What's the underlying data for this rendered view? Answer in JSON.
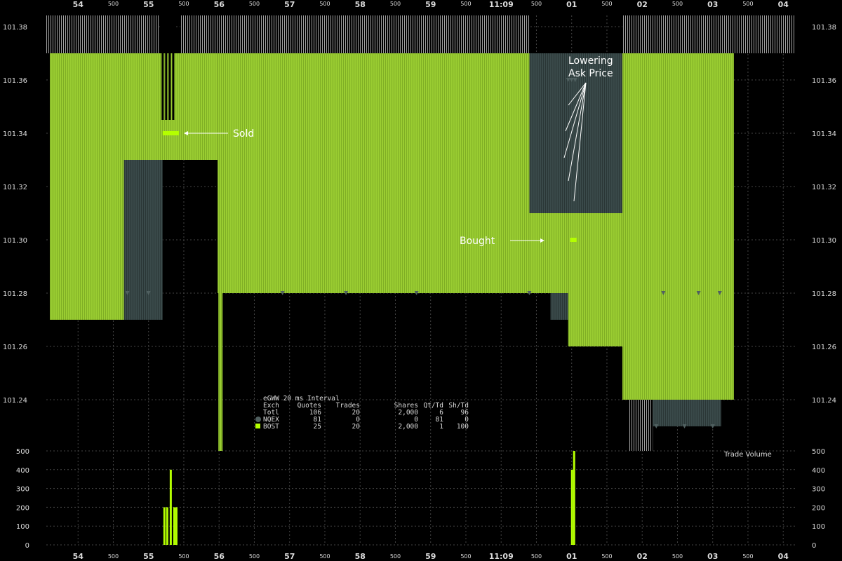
{
  "chart_data": {
    "type": "area",
    "title": "eGWW 20 ms Interval",
    "time_axis": {
      "major_labels": [
        "54",
        "55",
        "56",
        "57",
        "58",
        "59",
        "11:09",
        "01",
        "02",
        "03",
        "04"
      ],
      "minor_label": "500"
    },
    "price_axis": {
      "range": [
        101.23,
        101.39
      ],
      "ticks": [
        "101.38",
        "101.36",
        "101.34",
        "101.32",
        "101.30",
        "101.28",
        "101.26",
        "101.24"
      ]
    },
    "volume_axis": {
      "label": "Trade Volume",
      "range": [
        0,
        500
      ],
      "ticks": [
        "500",
        "400",
        "300",
        "200",
        "100",
        "0"
      ]
    },
    "colors": {
      "bost": "#9acd32",
      "bost_bright": "#b4ff00",
      "nqex": "#3a4a4a",
      "nqex_marker": "#506060",
      "grid": "#444444",
      "quote_vertical": "#a0a0a0"
    },
    "bost_bid": [
      {
        "t_start": 53.6,
        "t_end": 54.65,
        "price": 101.27
      },
      {
        "t_start": 54.65,
        "t_end": 55.98,
        "price": 101.28
      },
      {
        "t_start": 55.98,
        "t_end": 60.9,
        "price": 101.28
      },
      {
        "t_start": 60.9,
        "t_end": 61.3,
        "price": 101.3
      },
      {
        "t_start": 61.3,
        "t_end": 61.9,
        "price": 101.26
      },
      {
        "t_start": 61.9,
        "t_end": 63.3,
        "price": 101.24
      }
    ],
    "bost_ask": [
      {
        "t_start": 53.6,
        "t_end": 56.02,
        "price": 101.37
      },
      {
        "t_start": 56.02,
        "t_end": 60.4,
        "price": 101.37
      },
      {
        "t_start": 60.4,
        "t_end": 60.95,
        "price": 101.31
      },
      {
        "t_start": 60.95,
        "t_end": 61.72,
        "price": 101.31
      },
      {
        "t_start": 61.72,
        "t_end": 63.3,
        "price": 101.37
      }
    ],
    "nqex_bid": [
      {
        "t_start": 54.65,
        "t_end": 55.2,
        "price": 101.27
      },
      {
        "t_start": 60.7,
        "t_end": 60.95,
        "price": 101.27
      },
      {
        "t_start": 61.8,
        "t_end": 62.1,
        "price": 101.24
      },
      {
        "t_start": 62.15,
        "t_end": 63.12,
        "price": 101.23
      }
    ],
    "nqex_ask": [
      {
        "t_start": 54.65,
        "t_end": 55.98,
        "price": 101.33
      },
      {
        "t_start": 60.4,
        "t_end": 61.72,
        "price": 101.31
      }
    ],
    "trades": [
      {
        "exchange": "BOST",
        "t": 55.22,
        "price": 101.34,
        "volume": 200
      },
      {
        "exchange": "BOST",
        "t": 55.26,
        "price": 101.34,
        "volume": 200
      },
      {
        "exchange": "BOST",
        "t": 55.31,
        "price": 101.34,
        "volume": 400
      },
      {
        "exchange": "BOST",
        "t": 55.36,
        "price": 101.34,
        "volume": 200
      },
      {
        "exchange": "BOST",
        "t": 55.39,
        "price": 101.34,
        "volume": 200
      },
      {
        "exchange": "BOST",
        "t": 61.0,
        "price": 101.3,
        "volume": 400
      },
      {
        "exchange": "BOST",
        "t": 61.03,
        "price": 101.3,
        "volume": 500
      }
    ],
    "annotations": [
      {
        "text": "Sold",
        "lines": [
          "Sold"
        ]
      },
      {
        "text": "Bought",
        "lines": [
          "Bought"
        ]
      },
      {
        "text": "Lowering Ask Price",
        "lines": [
          "Lowering",
          "Ask Price"
        ]
      }
    ],
    "stats_table": {
      "title": "eGWW 20 ms Interval",
      "headers": [
        "Exch",
        "Quotes",
        "Trades",
        "Shares",
        "Qt/Td",
        "Sh/Td"
      ],
      "rows": [
        {
          "exch": "Totl",
          "quotes": "106",
          "trades": "20",
          "shares": "2,000",
          "qt_td": "6",
          "sh_td": "96"
        },
        {
          "exch": "NQEX",
          "quotes": "81",
          "trades": "0",
          "shares": "0",
          "qt_td": "81",
          "sh_td": "0"
        },
        {
          "exch": "BOST",
          "quotes": "25",
          "trades": "20",
          "shares": "2,000",
          "qt_td": "1",
          "sh_td": "100"
        }
      ]
    },
    "grid": true
  }
}
